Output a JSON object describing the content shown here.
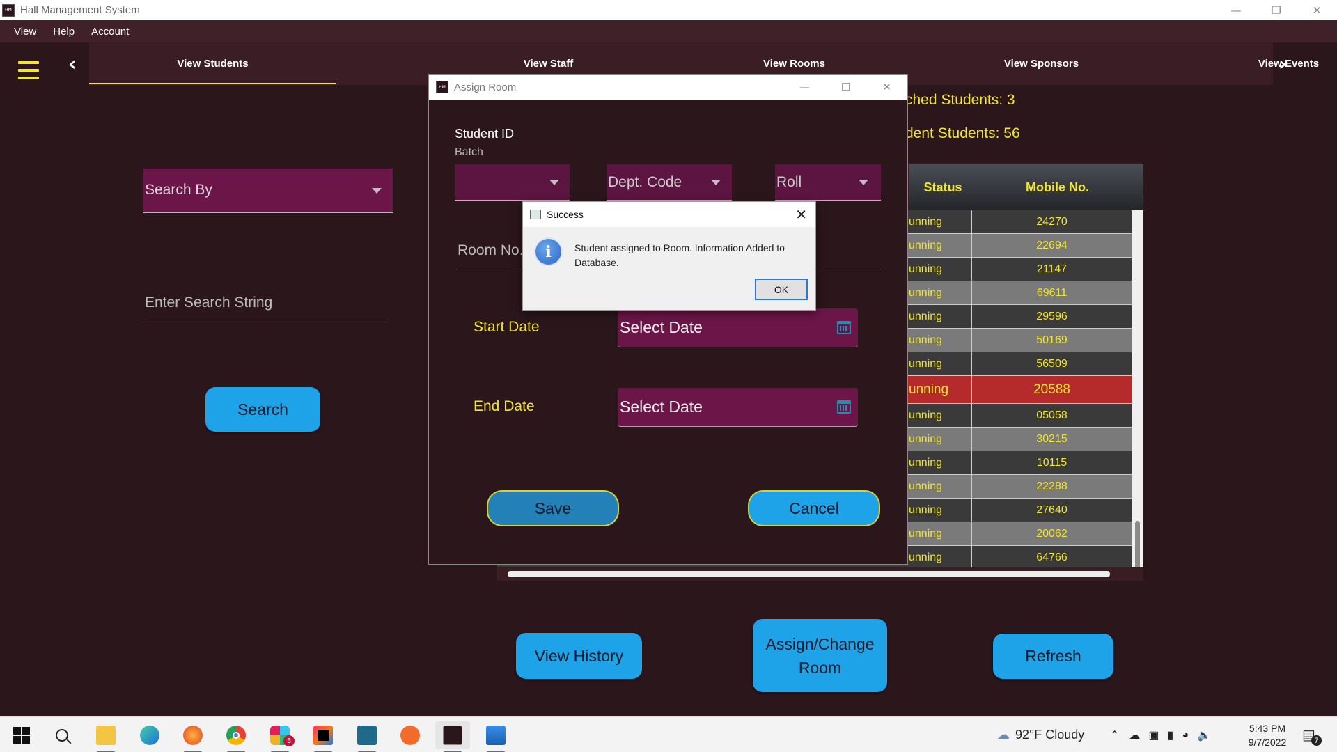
{
  "window": {
    "title": "Hall Management System"
  },
  "menu": [
    "View",
    "Help",
    "Account"
  ],
  "tabs": [
    "View Students",
    "View Staff",
    "View Rooms",
    "View Sponsors",
    "View Events"
  ],
  "left": {
    "search_by": "Search By",
    "search_placeholder": "Enter Search String",
    "search_button": "Search"
  },
  "counts": {
    "matched": "ched Students: 3",
    "resident": "dent Students: 56"
  },
  "table": {
    "columns": [
      "Status",
      "Mobile No."
    ],
    "rows": [
      {
        "status": "unning",
        "mobile": "24270"
      },
      {
        "status": "unning",
        "mobile": "22694"
      },
      {
        "status": "unning",
        "mobile": "21147"
      },
      {
        "status": "unning",
        "mobile": "69611"
      },
      {
        "status": "unning",
        "mobile": "29596"
      },
      {
        "status": "unning",
        "mobile": "50169"
      },
      {
        "status": "unning",
        "mobile": "56509"
      },
      {
        "status": "unning",
        "mobile": "20588",
        "selected": true
      },
      {
        "status": "unning",
        "mobile": "05058"
      },
      {
        "status": "unning",
        "mobile": "30215"
      },
      {
        "status": "unning",
        "mobile": "10115"
      },
      {
        "status": "unning",
        "mobile": "22288"
      },
      {
        "status": "unning",
        "mobile": "27640"
      },
      {
        "status": "unning",
        "mobile": "20062"
      },
      {
        "status": "unning",
        "mobile": "64766"
      }
    ]
  },
  "bottom_buttons": {
    "history": "View History",
    "assign_line1": "Assign/Change",
    "assign_line2": "Room",
    "refresh": "Refresh"
  },
  "assign_dialog": {
    "title": "Assign Room",
    "student_id": "Student ID",
    "batch": "Batch",
    "batch_value": "",
    "dept_code": "Dept. Code",
    "roll": "Roll",
    "room_no": "Room No.",
    "start_date": "Start Date",
    "end_date": "End Date",
    "date_placeholder": "Select Date",
    "save": "Save",
    "cancel": "Cancel"
  },
  "success_dialog": {
    "title": "Success",
    "message": "Student assigned to Room. Information Added to Database.",
    "ok": "OK"
  },
  "taskbar": {
    "weather": "92°F  Cloudy",
    "time": "5:43 PM",
    "date": "9/7/2022",
    "slack_badge": "5",
    "notif_count": "7"
  },
  "colors": {
    "accent_yellow": "#f2e62e",
    "button_blue": "#1fa3e8",
    "field_purple": "#6c1548",
    "selected_row": "#b52b2b",
    "background": "#2b161b"
  }
}
